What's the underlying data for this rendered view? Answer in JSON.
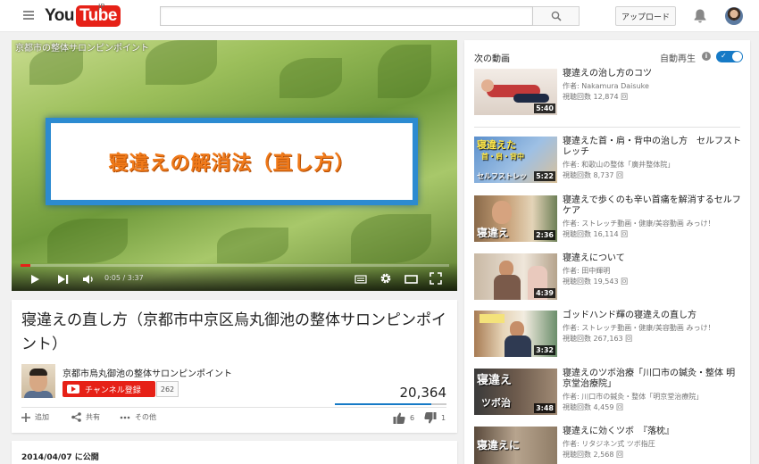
{
  "masthead": {
    "logo_you": "You",
    "logo_tube": "Tube",
    "region": "JP",
    "search_placeholder": "",
    "upload_label": "アップロード"
  },
  "player": {
    "overlay_title": "京都市の整体サロンピンポイント",
    "card_text": "寝違えの解消法（直し方）",
    "time": "0:05 / 3:37",
    "progress": 0.023
  },
  "video": {
    "title": "寝違えの直し方（京都市中京区烏丸御池の整体サロンピンポイント）",
    "channel_name": "京都市烏丸御池の整体サロンピンポイント",
    "subscribe_label": "チャンネル登録",
    "subscriber_count": "262",
    "view_count": "20,364",
    "like_ratio": 0.86,
    "actions": {
      "add": "追加",
      "share": "共有",
      "more": "その他",
      "likes": "6",
      "dislikes": "1"
    },
    "published": "2014/04/07 に公開"
  },
  "sidebar": {
    "up_next": "次の動画",
    "autoplay_label": "自動再生",
    "autoplay_on": true,
    "items": [
      {
        "title": "寝違えの治し方のコツ",
        "author": "作者: Nakamura Daisuke",
        "views": "視聴回数 12,874 回",
        "duration": "5:40"
      },
      {
        "title": "寝違えた首・肩・背中の治し方　セルフストレッチ",
        "author": "作者: 和歌山の整体「廣井整体院」",
        "views": "視聴回数 8,737 回",
        "duration": "5:22"
      },
      {
        "title": "寝違えで歩くのも辛い首痛を解消するセルフケア",
        "author": "作者: ストレッチ動画・健康/美容動画 みっけ！",
        "views": "視聴回数 16,114 回",
        "duration": "2:36"
      },
      {
        "title": "寝違えについて",
        "author": "作者: 田中輝明",
        "views": "視聴回数 19,543 回",
        "duration": "4:39"
      },
      {
        "title": "ゴッドハンド輝の寝違えの直し方",
        "author": "作者: ストレッチ動画・健康/美容動画 みっけ！",
        "views": "視聴回数 267,163 回",
        "duration": "3:32"
      },
      {
        "title": "寝違えのツボ治療「川口市の鍼灸・整体 明京堂治療院」",
        "author": "作者: 川口市の鍼灸・整体「明京堂治療院」",
        "views": "視聴回数 4,459 回",
        "duration": "3:48"
      },
      {
        "title": "寝違えに効くツボ　『落枕』",
        "author": "作者: リタジネン式 ツボ指圧",
        "views": "視聴回数 2,568 回",
        "duration": ""
      }
    ],
    "thumb_texts": {
      "t2": "寝違えた",
      "t2b": "首・肩・背中",
      "t2c": "セルフストレッ",
      "t3": "寝違え",
      "t6": "寝違え",
      "t6b": "ツボ治",
      "t7": "寝違えに"
    }
  },
  "colors": {
    "brand_red": "#e62117",
    "link_blue": "#167ac6",
    "page_bg": "#f1f1f1"
  }
}
